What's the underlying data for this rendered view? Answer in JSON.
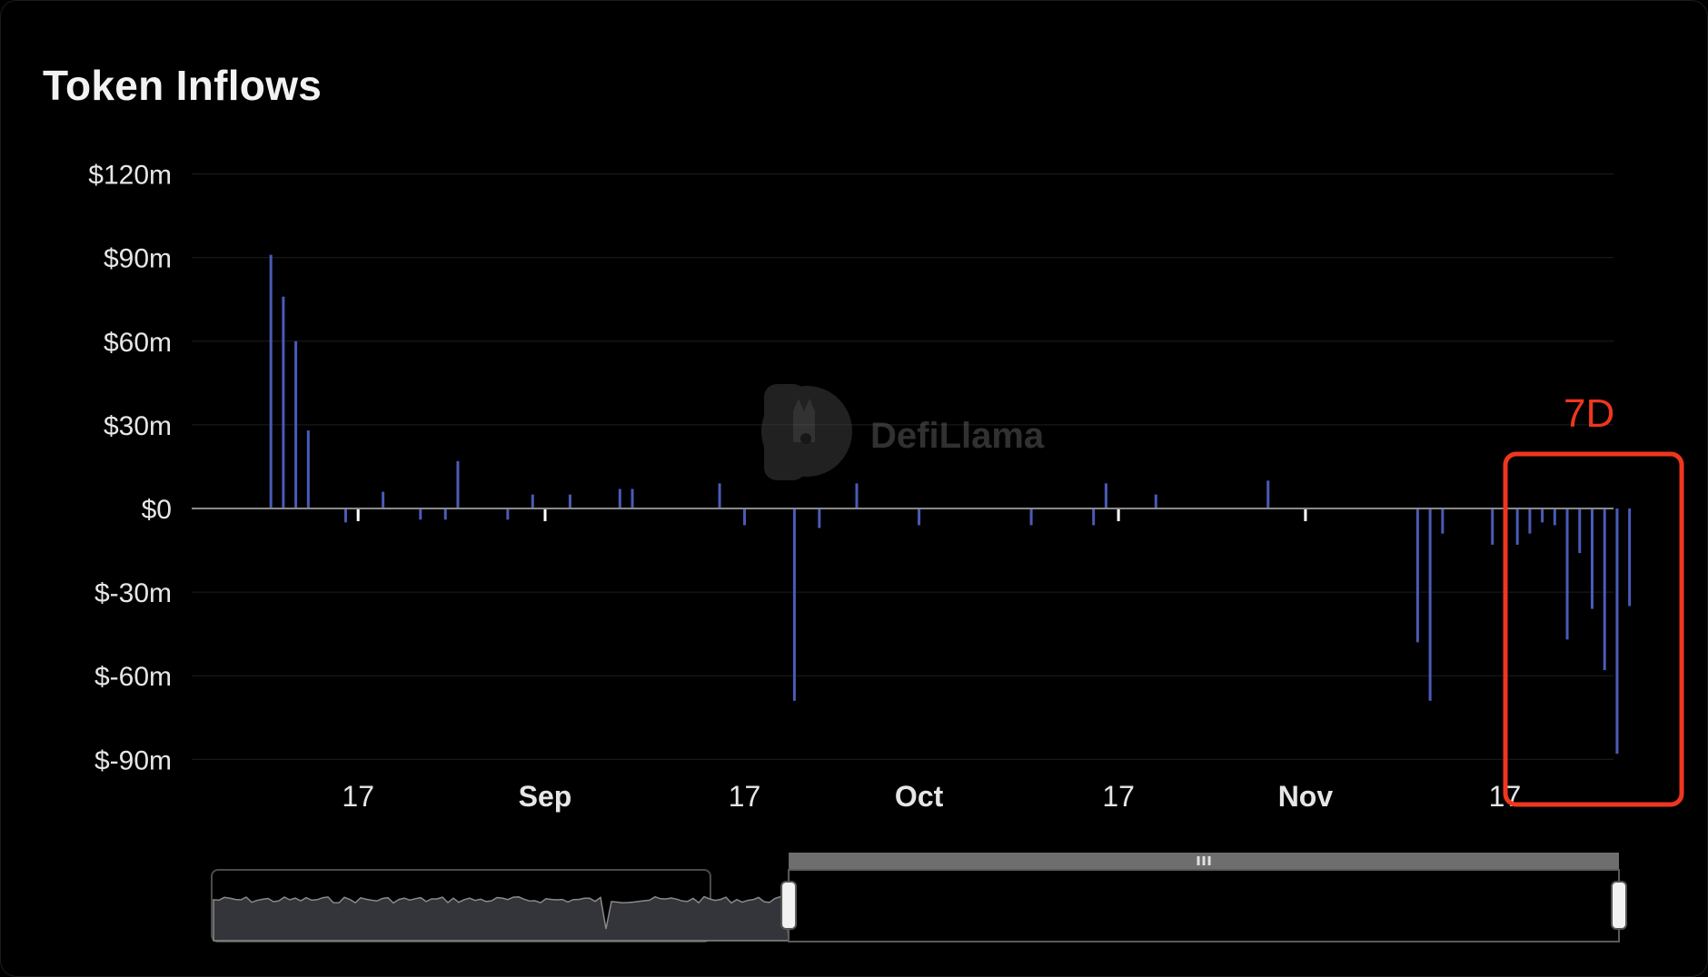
{
  "card": {
    "title": "Token Inflows"
  },
  "watermark": {
    "text": "DefiLlama",
    "icon": "llama-logo-icon"
  },
  "annotation": {
    "label": "7D",
    "color": "#f0361e"
  },
  "colors": {
    "bar": "#4a5bb8",
    "background": "#000000",
    "grid": "#1e1e1e",
    "zero_line": "#8a8a8a",
    "slider_fill": "#33353b"
  },
  "chart_data": {
    "type": "bar",
    "title": "Token Inflows",
    "xlabel": "",
    "ylabel": "",
    "x_range": [
      "2024-08-07",
      "2024-11-26"
    ],
    "ylim": [
      -100,
      120
    ],
    "y_ticks": [
      120,
      90,
      60,
      30,
      0,
      -30,
      -60,
      -90
    ],
    "y_tick_labels": [
      "$120m",
      "$90m",
      "$60m",
      "$30m",
      "$0",
      "$-30m",
      "$-60m",
      "$-90m"
    ],
    "x_ticks": [
      {
        "date": "2024-08-17",
        "label": "17",
        "major": false
      },
      {
        "date": "2024-09-01",
        "label": "Sep",
        "major": true
      },
      {
        "date": "2024-09-17",
        "label": "17",
        "major": false
      },
      {
        "date": "2024-10-01",
        "label": "Oct",
        "major": true
      },
      {
        "date": "2024-10-17",
        "label": "17",
        "major": false
      },
      {
        "date": "2024-11-01",
        "label": "Nov",
        "major": true
      },
      {
        "date": "2024-11-17",
        "label": "17",
        "major": false
      }
    ],
    "grid": true,
    "legend": "none",
    "series": [
      {
        "values": [
          [
            "2024-08-10",
            91
          ],
          [
            "2024-08-11",
            76
          ],
          [
            "2024-08-12",
            60
          ],
          [
            "2024-08-13",
            28
          ],
          [
            "2024-08-16",
            -5
          ],
          [
            "2024-08-17",
            -3
          ],
          [
            "2024-08-19",
            6
          ],
          [
            "2024-08-22",
            -4
          ],
          [
            "2024-08-24",
            -4
          ],
          [
            "2024-08-25",
            17
          ],
          [
            "2024-08-29",
            -4
          ],
          [
            "2024-08-31",
            5
          ],
          [
            "2024-09-01",
            -3
          ],
          [
            "2024-09-03",
            5
          ],
          [
            "2024-09-07",
            7
          ],
          [
            "2024-09-08",
            7
          ],
          [
            "2024-09-15",
            9
          ],
          [
            "2024-09-17",
            -6
          ],
          [
            "2024-09-21",
            -69
          ],
          [
            "2024-09-23",
            -7
          ],
          [
            "2024-09-26",
            9
          ],
          [
            "2024-10-01",
            -6
          ],
          [
            "2024-10-10",
            -6
          ],
          [
            "2024-10-15",
            -6
          ],
          [
            "2024-10-16",
            9
          ],
          [
            "2024-10-17",
            -3
          ],
          [
            "2024-10-20",
            5
          ],
          [
            "2024-10-29",
            10
          ],
          [
            "2024-11-01",
            -3
          ],
          [
            "2024-11-10",
            -48
          ],
          [
            "2024-11-11",
            -69
          ],
          [
            "2024-11-12",
            -9
          ],
          [
            "2024-11-16",
            -13
          ],
          [
            "2024-11-17",
            -3
          ],
          [
            "2024-11-18",
            -13
          ],
          [
            "2024-11-19",
            -9
          ],
          [
            "2024-11-20",
            -5
          ],
          [
            "2024-11-21",
            -6
          ],
          [
            "2024-11-22",
            -47
          ],
          [
            "2024-11-23",
            -16
          ],
          [
            "2024-11-24",
            -36
          ],
          [
            "2024-11-25",
            -58
          ],
          [
            "2024-11-26",
            -88
          ],
          [
            "2024-11-27",
            -35
          ]
        ]
      }
    ],
    "highlight_bars": [
      "2024-08-17",
      "2024-09-01",
      "2024-10-17",
      "2024-11-01",
      "2024-11-17"
    ],
    "zoom_slider": {
      "range_start": 0.41,
      "range_end": 1.0
    }
  }
}
